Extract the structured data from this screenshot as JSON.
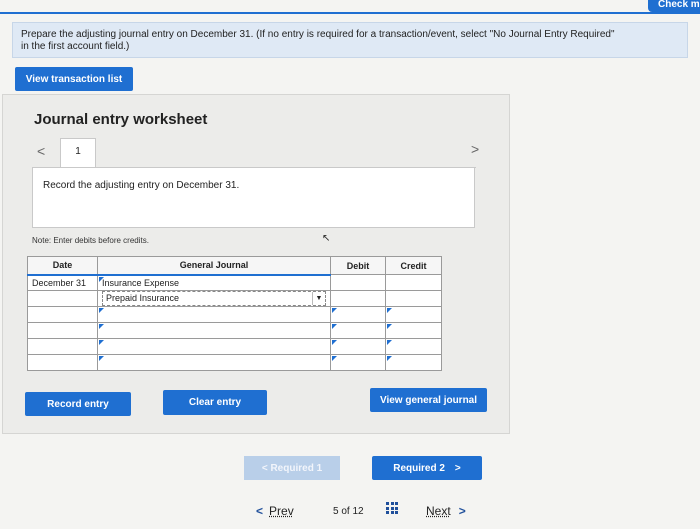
{
  "header": {
    "check_label": "Check m"
  },
  "prompt": {
    "line1": "Prepare the adjusting journal entry on December 31. (If no entry is required for a transaction/event, select \"No Journal Entry Required\"",
    "line2": "in the first account field.)"
  },
  "buttons": {
    "view_transaction_list": "View transaction list",
    "record_entry": "Record entry",
    "clear_entry": "Clear entry",
    "view_general_journal": "View general journal",
    "required_1": "< Required 1",
    "required_2": "Required 2",
    "required_2_chevron": ">"
  },
  "worksheet": {
    "title": "Journal entry worksheet",
    "tab_number": "1",
    "prev_chevron": "<",
    "next_chevron": ">",
    "instruction": "Record the adjusting entry on December 31.",
    "note": "Note: Enter debits before credits."
  },
  "journal_table": {
    "headers": {
      "date": "Date",
      "general_journal": "General Journal",
      "debit": "Debit",
      "credit": "Credit"
    },
    "rows": [
      {
        "date": "December 31",
        "account": "Insurance Expense",
        "debit": "",
        "credit": ""
      },
      {
        "date": "",
        "account": "Prepaid Insurance",
        "debit": "",
        "credit": ""
      },
      {
        "date": "",
        "account": "",
        "debit": "",
        "credit": ""
      },
      {
        "date": "",
        "account": "",
        "debit": "",
        "credit": ""
      },
      {
        "date": "",
        "account": "",
        "debit": "",
        "credit": ""
      },
      {
        "date": "",
        "account": "",
        "debit": "",
        "credit": ""
      }
    ]
  },
  "pagination": {
    "prev_label": "Prev",
    "prev_chevron": "<",
    "current": "5",
    "of_label": "of",
    "total": "12",
    "next_label": "Next",
    "next_chevron": ">"
  },
  "colors": {
    "accent": "#1f6fd1",
    "prompt_bg": "#dfe9f5"
  }
}
